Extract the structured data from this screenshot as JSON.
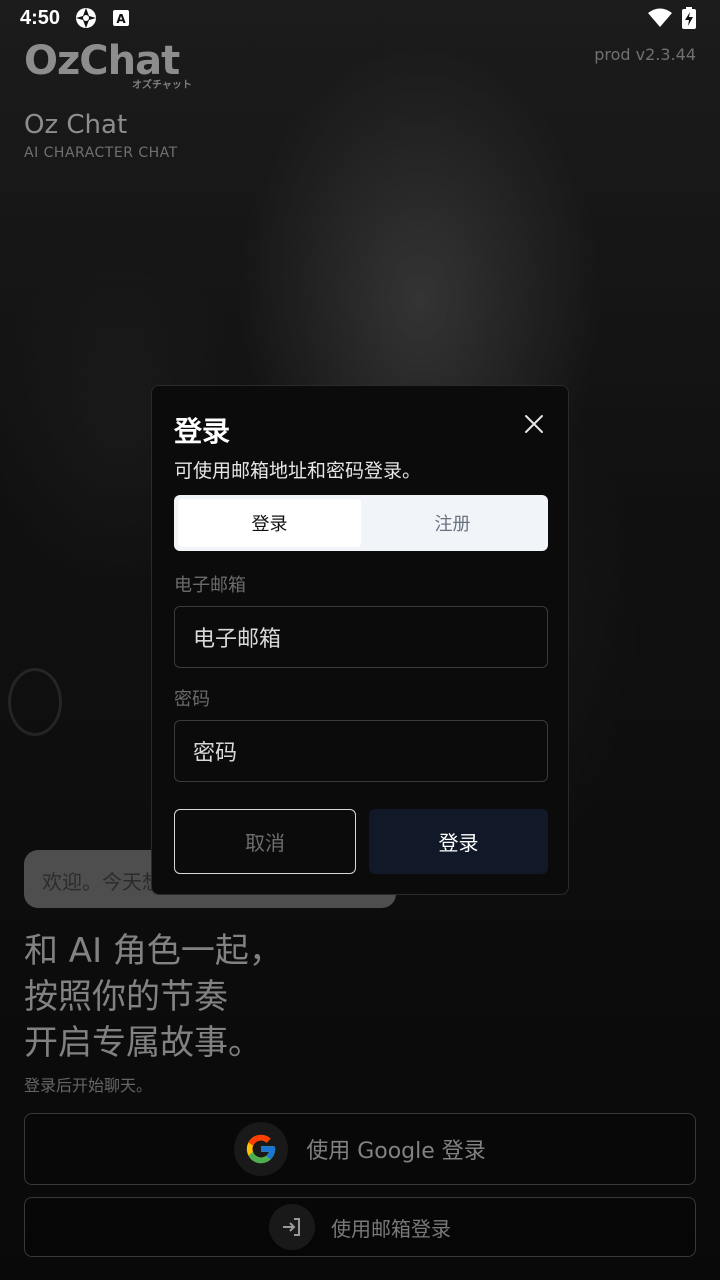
{
  "status_bar": {
    "time": "4:50",
    "icons": [
      "aperture-icon",
      "font-a-icon",
      "wifi-icon",
      "battery-charging-icon"
    ]
  },
  "header": {
    "logo_text": "OzChat",
    "logo_sub": "オズチャット",
    "version": "prod v2.3.44",
    "app_title": "Oz Chat",
    "app_subtitle": "AI CHARACTER CHAT"
  },
  "welcome_bubble": "欢迎。今天想",
  "tagline": [
    "和 AI 角色一起，",
    "按照你的节奏",
    "开启专属故事。"
  ],
  "hint": "登录后开始聊天。",
  "google_button": {
    "label": "使用 Google 登录",
    "icon": "google-icon"
  },
  "email_button": {
    "label": "使用邮箱登录",
    "icon": "login-arrow-icon"
  },
  "modal": {
    "title": "登录",
    "description": "可使用邮箱地址和密码登录。",
    "tabs": [
      {
        "label": "登录",
        "active": true
      },
      {
        "label": "注册",
        "active": false
      }
    ],
    "email_label": "电子邮箱",
    "email_placeholder": "电子邮箱",
    "password_label": "密码",
    "password_placeholder": "密码",
    "cancel_label": "取消",
    "submit_label": "登录"
  },
  "colors": {
    "modal_bg": "#0b0b0b",
    "tab_active_bg": "#ffffff",
    "tab_track_bg": "#f1f4f8",
    "submit_bg": "#111827"
  }
}
